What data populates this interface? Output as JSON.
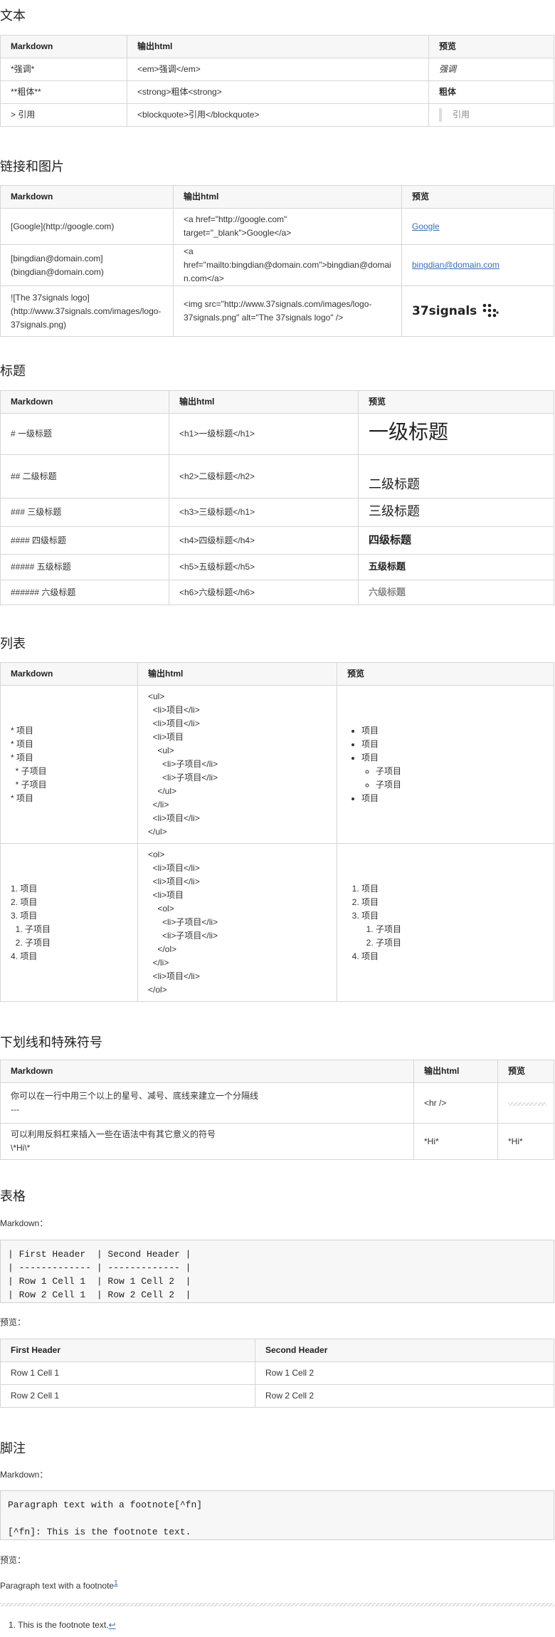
{
  "text": {
    "title": "文本",
    "h": [
      "Markdown",
      "输出html",
      "预览"
    ],
    "rows": [
      [
        "*强调*",
        "<em>强调</em>",
        "强调"
      ],
      [
        "**粗体**",
        "<strong>粗体<strong>",
        "粗体"
      ],
      [
        "> 引用",
        "<blockquote>引用</blockquote>",
        "引用"
      ]
    ]
  },
  "links": {
    "title": "链接和图片",
    "h": [
      "Markdown",
      "输出html",
      "预览"
    ],
    "rows": [
      [
        "[Google](http://google.com)",
        "<a href=\"http://google.com\" target=\"_blank\">Google</a>",
        "Google"
      ],
      [
        "[bingdian@domain.com](bingdian@domain.com)",
        "<a href=\"mailto:bingdian@domain.com\">bingdian@domain.com</a>",
        "bingdian@domain.com"
      ],
      [
        "![The 37signals logo](http://www.37signals.com/images/logo-37signals.png)",
        "<img src=\"http://www.37signals.com/images/logo-37signals.png\" alt=\"The 37signals logo\" />",
        "37signals"
      ]
    ]
  },
  "heads": {
    "title": "标题",
    "h": [
      "Markdown",
      "输出html",
      "预览"
    ],
    "rows": [
      [
        "# 一级标题",
        "<h1>一级标题</h1>",
        "一级标题"
      ],
      [
        "## 二级标题",
        "<h2>二级标题</h2>",
        "二级标题"
      ],
      [
        "### 三级标题",
        "<h3>三级标题</h1>",
        "三级标题"
      ],
      [
        "#### 四级标题",
        "<h4>四级标题</h4>",
        "四级标题"
      ],
      [
        "##### 五级标题",
        "<h5>五级标题</h5>",
        "五级标题"
      ],
      [
        "###### 六级标题",
        "<h6>六级标题</h6>",
        "六级标题"
      ]
    ]
  },
  "lists": {
    "title": "列表",
    "h": [
      "Markdown",
      "输出html",
      "预览"
    ],
    "ul_md": [
      "* 项目",
      "* 项目",
      "* 项目",
      "  * 子项目",
      "  * 子项目",
      "* 项目"
    ],
    "ul_html": [
      "<ul>",
      "  <li>项目</li>",
      "  <li>项目</li>",
      "  <li>项目",
      "    <ul>",
      "      <li>子项目</li>",
      "      <li>子项目</li>",
      "    </ul>",
      "  </li>",
      "  <li>项目</li>",
      "</ul>"
    ],
    "ol_md": [
      "1. 项目",
      "2. 项目",
      "3. 项目",
      "  1. 子项目",
      "  2. 子项目",
      "4. 项目"
    ],
    "ol_html": [
      "<ol>",
      "  <li>项目</li>",
      "  <li>项目</li>",
      "  <li>项目",
      "    <ol>",
      "      <li>子项目</li>",
      "      <li>子项目</li>",
      "    </ol>",
      "  </li>",
      "  <li>项目</li>",
      "</ol>"
    ],
    "item": "项目",
    "sub": "子项目"
  },
  "special": {
    "title": "下划线和特殊符号",
    "h": [
      "Markdown",
      "输出html",
      "预览"
    ],
    "r1a": "你可以在一行中用三个以上的星号、减号、底线来建立一个分隔线",
    "r1b": "---",
    "r1c": "<hr />",
    "r2a": "可以利用反斜杠来插入一些在语法中有其它意义的符号",
    "r2b": "\\*Hi\\*",
    "r2c": "*Hi*",
    "r2d": "*Hi*"
  },
  "tables": {
    "title": "表格",
    "md_label": "Markdown：",
    "code": [
      "| First Header  | Second Header |",
      "| ------------- | ------------- |",
      "| Row 1 Cell 1  | Row 1 Cell 2  |",
      "| Row 2 Cell 1  | Row 2 Cell 2  |"
    ],
    "prev_label": "预览：",
    "h": [
      "First Header",
      "Second Header"
    ],
    "rows": [
      [
        "Row 1 Cell 1",
        "Row 1 Cell 2"
      ],
      [
        "Row 2 Cell 1",
        "Row 2 Cell 2"
      ]
    ]
  },
  "foot": {
    "title": "脚注",
    "md_label": "Markdown：",
    "code": [
      "Paragraph text with a footnote[^fn]",
      "",
      "[^fn]: This is the footnote text."
    ],
    "prev_label": "预览：",
    "para": "Paragraph text with a footnote",
    "sup": "1",
    "note": "This is the footnote text.",
    "back": "↩"
  }
}
